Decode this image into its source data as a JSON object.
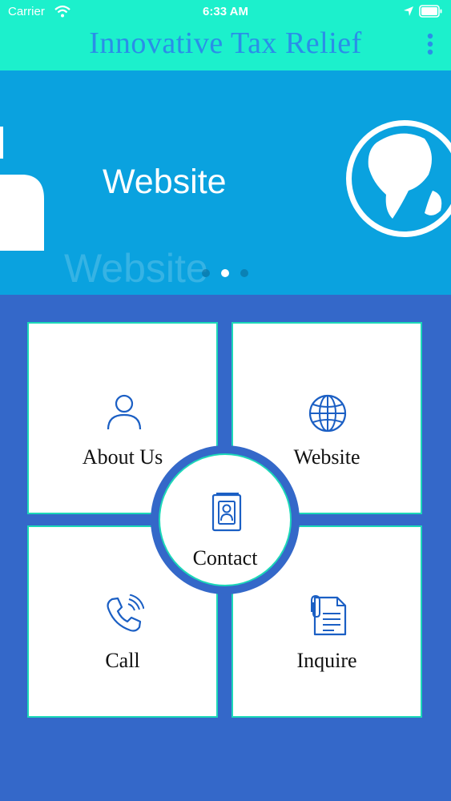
{
  "status_bar": {
    "carrier": "Carrier",
    "time": "6:33 AM"
  },
  "header": {
    "title": "Innovative Tax Relief",
    "menu_icon": "more-vertical-icon"
  },
  "banner": {
    "title": "Website",
    "watermark": "Website",
    "page_count": 3,
    "active_page": 2
  },
  "tiles": {
    "about": {
      "label": "About Us",
      "icon": "person-icon"
    },
    "website": {
      "label": "Website",
      "icon": "globe-icon"
    },
    "call": {
      "label": "Call",
      "icon": "phone-icon"
    },
    "inquire": {
      "label": "Inquire",
      "icon": "document-icon"
    },
    "contact": {
      "label": "Contact",
      "icon": "contact-book-icon"
    }
  },
  "colors": {
    "header_bg": "#1cf0cc",
    "title": "#2a8ee8",
    "banner_bg": "#0aa2df",
    "page_bg": "#3468c9",
    "icon": "#1b5fc4",
    "tile_border": "#1cd8b8"
  }
}
